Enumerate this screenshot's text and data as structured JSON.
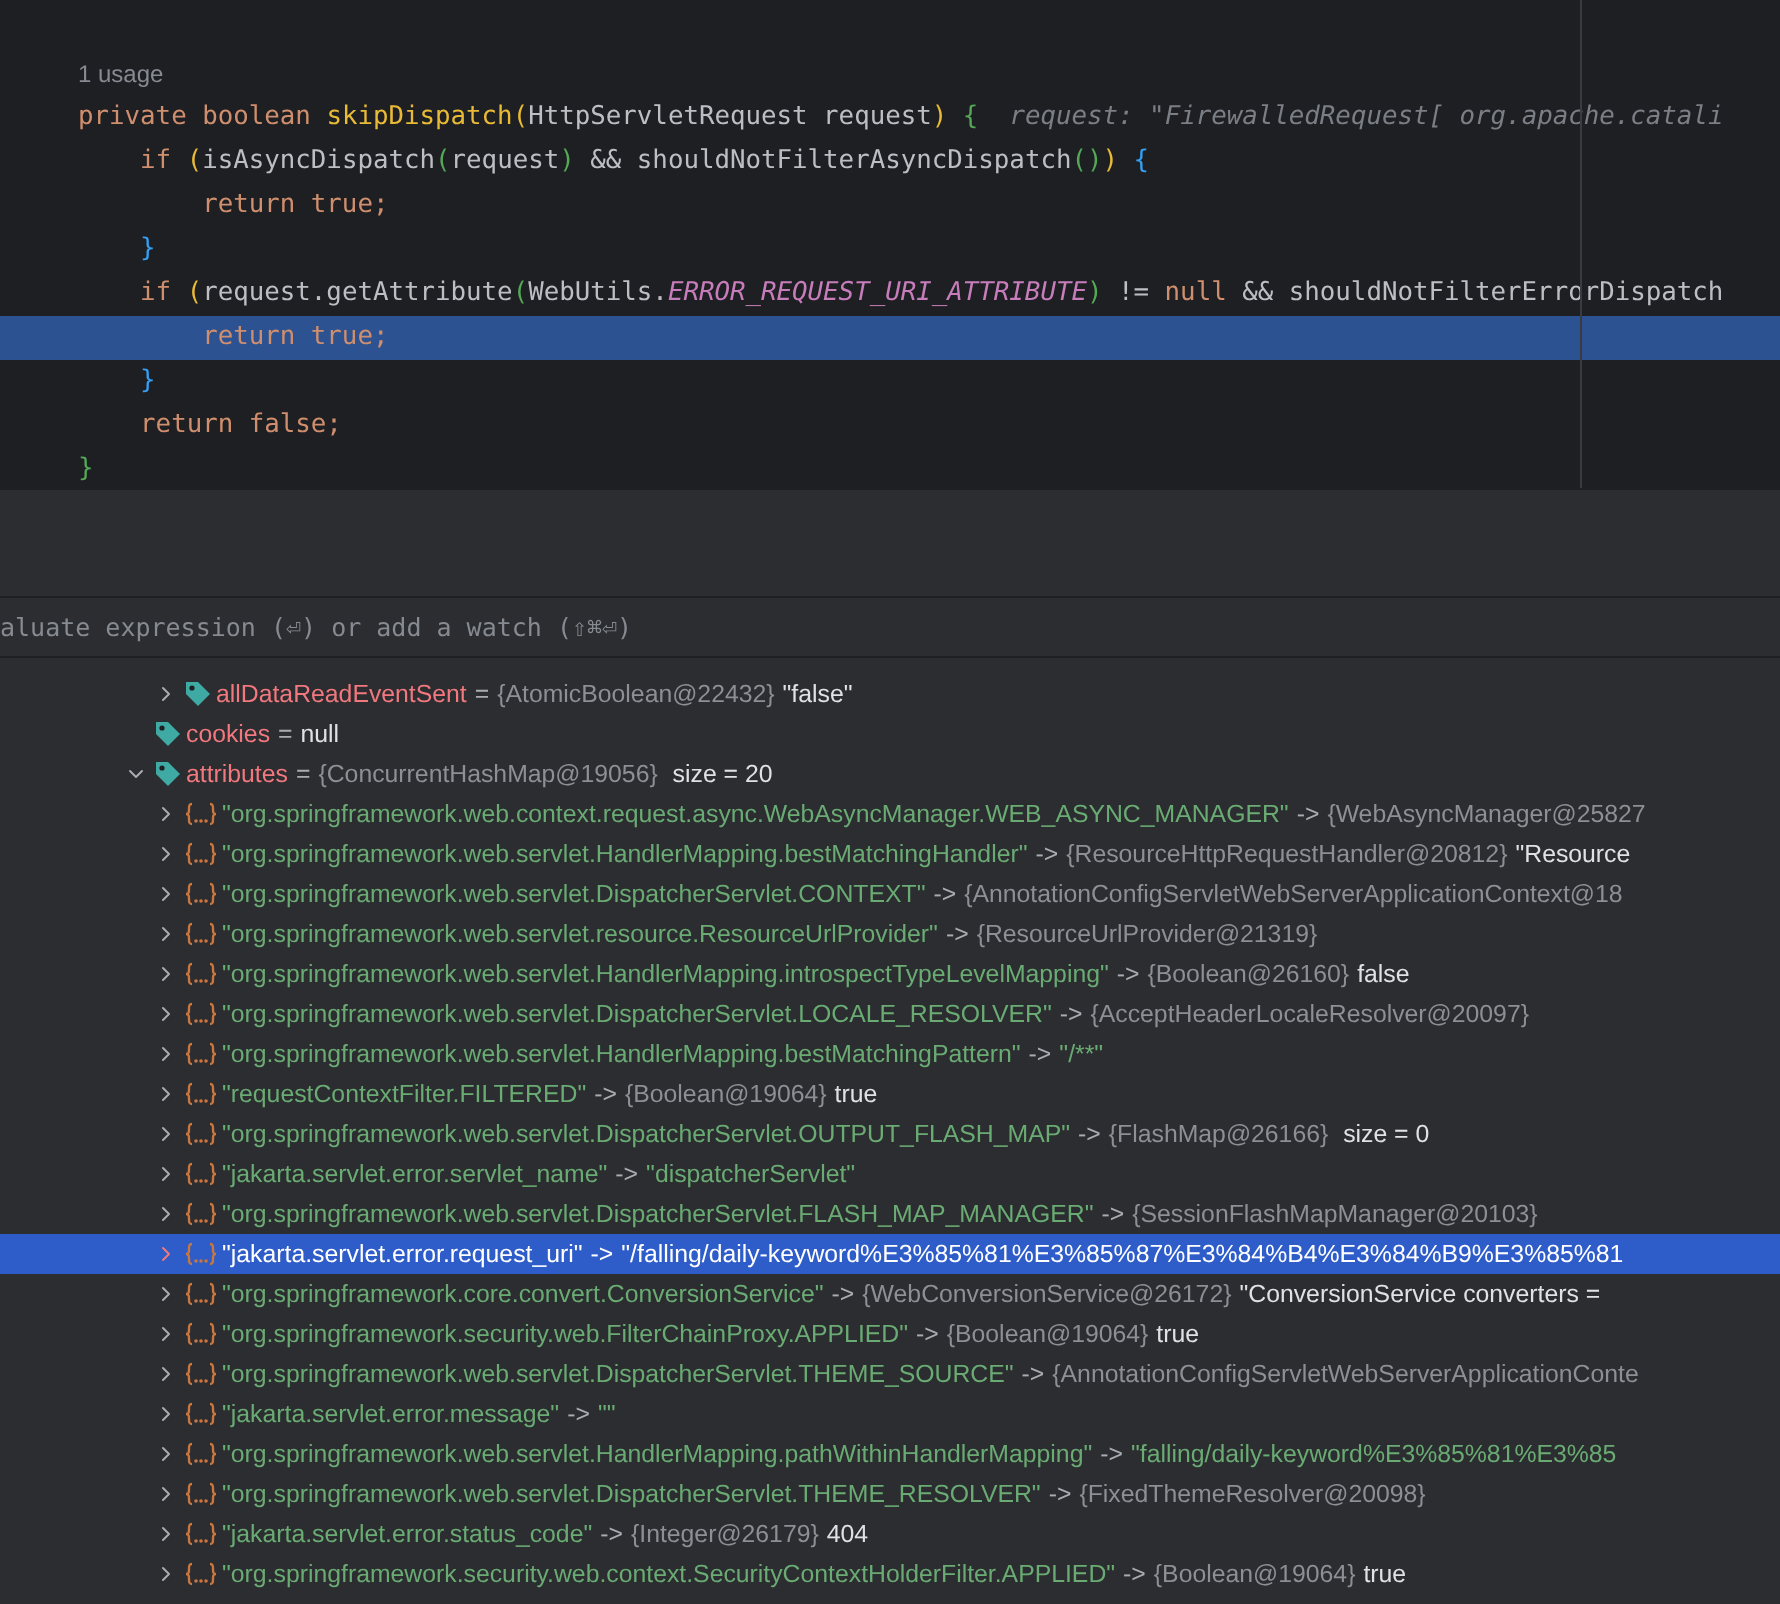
{
  "editor": {
    "usage_hint": "1 usage",
    "lines": [
      {
        "selected": false,
        "tokens": [
          {
            "kind": "kw",
            "text": "private boolean "
          },
          {
            "kind": "decl",
            "text": "skipDispatch"
          },
          {
            "kind": "paren1",
            "text": "("
          },
          {
            "kind": "plain",
            "text": "HttpServletRequest request"
          },
          {
            "kind": "paren1",
            "text": ")"
          },
          {
            "kind": "brace1",
            "text": " {"
          },
          {
            "kind": "hint",
            "text": "  request: \"FirewalledRequest[ org.apache.catali"
          }
        ]
      },
      {
        "selected": false,
        "tokens": [
          {
            "kind": "kw",
            "text": "    if "
          },
          {
            "kind": "paren1",
            "text": "("
          },
          {
            "kind": "plain",
            "text": "isAsyncDispatch"
          },
          {
            "kind": "paren2",
            "text": "("
          },
          {
            "kind": "plain",
            "text": "request"
          },
          {
            "kind": "paren2",
            "text": ")"
          },
          {
            "kind": "plain",
            "text": " && shouldNotFilterAsyncDispatch"
          },
          {
            "kind": "paren2",
            "text": "()"
          },
          {
            "kind": "paren1",
            "text": ")"
          },
          {
            "kind": "brace2",
            "text": " {"
          }
        ]
      },
      {
        "selected": false,
        "tokens": [
          {
            "kind": "kw",
            "text": "        return true;"
          }
        ]
      },
      {
        "selected": false,
        "tokens": [
          {
            "kind": "brace2",
            "text": "    }"
          }
        ]
      },
      {
        "selected": false,
        "tokens": [
          {
            "kind": "kw",
            "text": "    if "
          },
          {
            "kind": "paren1",
            "text": "("
          },
          {
            "kind": "plain",
            "text": "request.getAttribute"
          },
          {
            "kind": "paren2",
            "text": "("
          },
          {
            "kind": "plain",
            "text": "WebUtils."
          },
          {
            "kind": "const",
            "text": "ERROR_REQUEST_URI_ATTRIBUTE"
          },
          {
            "kind": "paren2",
            "text": ")"
          },
          {
            "kind": "plain",
            "text": " != "
          },
          {
            "kind": "kw",
            "text": "null"
          },
          {
            "kind": "plain",
            "text": " && shouldNotFilterErrorDispatch"
          }
        ]
      },
      {
        "selected": true,
        "tokens": [
          {
            "kind": "kw",
            "text": "        return true;"
          }
        ]
      },
      {
        "selected": false,
        "tokens": [
          {
            "kind": "brace2",
            "text": "    }"
          }
        ]
      },
      {
        "selected": false,
        "tokens": [
          {
            "kind": "kw",
            "text": "    return false;"
          }
        ]
      },
      {
        "selected": false,
        "tokens": [
          {
            "kind": "brace1",
            "text": "}"
          }
        ]
      }
    ]
  },
  "evaluate_field": {
    "placeholder": "aluate expression (⏎) or add a watch (⇧⌘⏎)"
  },
  "variables": {
    "scrolled_children": [
      {
        "kind": "field",
        "expanded": false,
        "name": "allDataReadEventSent",
        "parts": [
          {
            "kind": "op",
            "text": "="
          },
          {
            "kind": "type",
            "text": "{AtomicBoolean@22432}"
          },
          {
            "kind": "value",
            "text": "\"false\""
          }
        ]
      }
    ],
    "items": [
      {
        "kind": "field",
        "name": "cookies",
        "parts": [
          {
            "kind": "op",
            "text": "="
          },
          {
            "kind": "value",
            "text": "null"
          }
        ]
      },
      {
        "kind": "field",
        "expanded": true,
        "name": "attributes",
        "parts": [
          {
            "kind": "op",
            "text": "="
          },
          {
            "kind": "type",
            "text": "{ConcurrentHashMap@19056}"
          },
          {
            "kind": "value",
            "text": " size = 20"
          }
        ],
        "children": [
          {
            "kind": "entry",
            "selected": false,
            "name": "\"org.springframework.web.context.request.async.WebAsyncManager.WEB_ASYNC_MANAGER\"",
            "parts": [
              {
                "kind": "op",
                "text": "->"
              },
              {
                "kind": "type",
                "text": "{WebAsyncManager@25827"
              }
            ]
          },
          {
            "kind": "entry",
            "selected": false,
            "name": "\"org.springframework.web.servlet.HandlerMapping.bestMatchingHandler\"",
            "parts": [
              {
                "kind": "op",
                "text": "->"
              },
              {
                "kind": "type",
                "text": "{ResourceHttpRequestHandler@20812}"
              },
              {
                "kind": "value",
                "text": "\"Resource"
              }
            ]
          },
          {
            "kind": "entry",
            "selected": false,
            "name": "\"org.springframework.web.servlet.DispatcherServlet.CONTEXT\"",
            "parts": [
              {
                "kind": "op",
                "text": "->"
              },
              {
                "kind": "type",
                "text": "{AnnotationConfigServletWebServerApplicationContext@18"
              }
            ]
          },
          {
            "kind": "entry",
            "selected": false,
            "name": "\"org.springframework.web.servlet.resource.ResourceUrlProvider\"",
            "parts": [
              {
                "kind": "op",
                "text": "->"
              },
              {
                "kind": "type",
                "text": "{ResourceUrlProvider@21319}"
              }
            ]
          },
          {
            "kind": "entry",
            "selected": false,
            "name": "\"org.springframework.web.servlet.HandlerMapping.introspectTypeLevelMapping\"",
            "parts": [
              {
                "kind": "op",
                "text": "->"
              },
              {
                "kind": "type",
                "text": "{Boolean@26160}"
              },
              {
                "kind": "value",
                "text": "false"
              }
            ]
          },
          {
            "kind": "entry",
            "selected": false,
            "name": "\"org.springframework.web.servlet.DispatcherServlet.LOCALE_RESOLVER\"",
            "parts": [
              {
                "kind": "op",
                "text": "->"
              },
              {
                "kind": "type",
                "text": "{AcceptHeaderLocaleResolver@20097}"
              }
            ]
          },
          {
            "kind": "entry",
            "selected": false,
            "name": "\"org.springframework.web.servlet.HandlerMapping.bestMatchingPattern\"",
            "parts": [
              {
                "kind": "op",
                "text": "->"
              },
              {
                "kind": "string",
                "text": "\"/**\""
              }
            ]
          },
          {
            "kind": "entry",
            "selected": false,
            "name": "\"requestContextFilter.FILTERED\"",
            "parts": [
              {
                "kind": "op",
                "text": "->"
              },
              {
                "kind": "type",
                "text": "{Boolean@19064}"
              },
              {
                "kind": "value",
                "text": "true"
              }
            ]
          },
          {
            "kind": "entry",
            "selected": false,
            "name": "\"org.springframework.web.servlet.DispatcherServlet.OUTPUT_FLASH_MAP\"",
            "parts": [
              {
                "kind": "op",
                "text": "->"
              },
              {
                "kind": "type",
                "text": "{FlashMap@26166}"
              },
              {
                "kind": "value",
                "text": " size = 0"
              }
            ]
          },
          {
            "kind": "entry",
            "selected": false,
            "name": "\"jakarta.servlet.error.servlet_name\"",
            "parts": [
              {
                "kind": "op",
                "text": "->"
              },
              {
                "kind": "string",
                "text": "\"dispatcherServlet\""
              }
            ]
          },
          {
            "kind": "entry",
            "selected": false,
            "name": "\"org.springframework.web.servlet.DispatcherServlet.FLASH_MAP_MANAGER\"",
            "parts": [
              {
                "kind": "op",
                "text": "->"
              },
              {
                "kind": "type",
                "text": "{SessionFlashMapManager@20103}"
              }
            ]
          },
          {
            "kind": "entry",
            "selected": true,
            "name": "\"jakarta.servlet.error.request_uri\"",
            "parts": [
              {
                "kind": "op",
                "text": "->"
              },
              {
                "kind": "string",
                "text": "\"/falling/daily-keyword%E3%85%81%E3%85%87%E3%84%B4%E3%84%B9%E3%85%81"
              }
            ]
          },
          {
            "kind": "entry",
            "selected": false,
            "name": "\"org.springframework.core.convert.ConversionService\"",
            "parts": [
              {
                "kind": "op",
                "text": "->"
              },
              {
                "kind": "type",
                "text": "{WebConversionService@26172}"
              },
              {
                "kind": "value",
                "text": "\"ConversionService converters ="
              }
            ]
          },
          {
            "kind": "entry",
            "selected": false,
            "name": "\"org.springframework.security.web.FilterChainProxy.APPLIED\"",
            "parts": [
              {
                "kind": "op",
                "text": "->"
              },
              {
                "kind": "type",
                "text": "{Boolean@19064}"
              },
              {
                "kind": "value",
                "text": "true"
              }
            ]
          },
          {
            "kind": "entry",
            "selected": false,
            "name": "\"org.springframework.web.servlet.DispatcherServlet.THEME_SOURCE\"",
            "parts": [
              {
                "kind": "op",
                "text": "->"
              },
              {
                "kind": "type",
                "text": "{AnnotationConfigServletWebServerApplicationConte"
              }
            ]
          },
          {
            "kind": "entry",
            "selected": false,
            "name": "\"jakarta.servlet.error.message\"",
            "parts": [
              {
                "kind": "op",
                "text": "->"
              },
              {
                "kind": "string",
                "text": "\"\""
              }
            ]
          },
          {
            "kind": "entry",
            "selected": false,
            "name": "\"org.springframework.web.servlet.HandlerMapping.pathWithinHandlerMapping\"",
            "parts": [
              {
                "kind": "op",
                "text": "->"
              },
              {
                "kind": "string",
                "text": "\"falling/daily-keyword%E3%85%81%E3%85"
              }
            ]
          },
          {
            "kind": "entry",
            "selected": false,
            "name": "\"org.springframework.web.servlet.DispatcherServlet.THEME_RESOLVER\"",
            "parts": [
              {
                "kind": "op",
                "text": "->"
              },
              {
                "kind": "type",
                "text": "{FixedThemeResolver@20098}"
              }
            ]
          },
          {
            "kind": "entry",
            "selected": false,
            "name": "\"jakarta.servlet.error.status_code\"",
            "parts": [
              {
                "kind": "op",
                "text": "->"
              },
              {
                "kind": "type",
                "text": "{Integer@26179}"
              },
              {
                "kind": "value",
                "text": "404"
              }
            ]
          },
          {
            "kind": "entry",
            "selected": false,
            "name": "\"org.springframework.security.web.context.SecurityContextHolderFilter.APPLIED\"",
            "parts": [
              {
                "kind": "op",
                "text": "->"
              },
              {
                "kind": "type",
                "text": "{Boolean@19064}"
              },
              {
                "kind": "value",
                "text": "true"
              }
            ]
          }
        ]
      }
    ]
  }
}
